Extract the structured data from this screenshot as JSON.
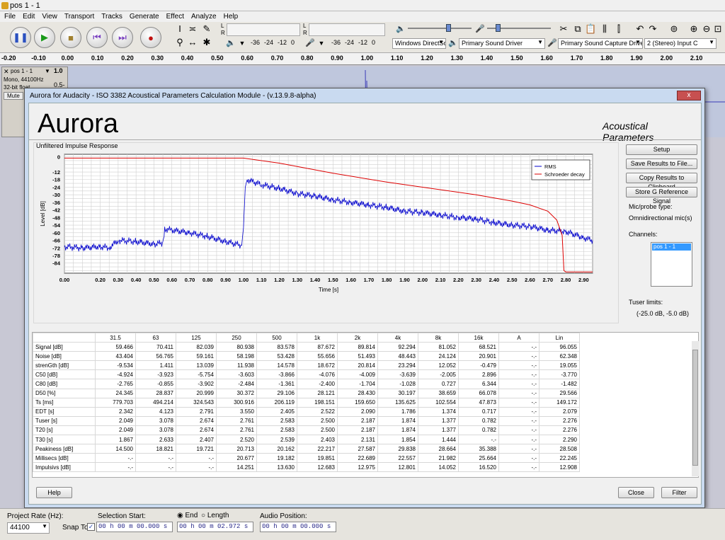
{
  "window": {
    "title": "pos 1 - 1"
  },
  "menu": [
    "File",
    "Edit",
    "View",
    "Transport",
    "Tracks",
    "Generate",
    "Effect",
    "Analyze",
    "Help"
  ],
  "toolbar": {
    "meter_play_ticks": [
      "-36",
      "-24",
      "-12",
      "0"
    ],
    "meter_rec_ticks": [
      "-36",
      "-24",
      "-12",
      "0"
    ],
    "host": "Windows DirectSo",
    "output_device": "Primary Sound Driver",
    "input_device": "Primary Sound Capture Driver",
    "channels": "2 (Stereo) Input C",
    "meter_l": "L",
    "meter_r": "R"
  },
  "ruler": [
    "-0.20",
    "-0.10",
    "0.00",
    "0.10",
    "0.20",
    "0.30",
    "0.40",
    "0.50",
    "0.60",
    "0.70",
    "0.80",
    "0.90",
    "1.00",
    "1.10",
    "1.20",
    "1.30",
    "1.40",
    "1.50",
    "1.60",
    "1.70",
    "1.80",
    "1.90",
    "2.00",
    "2.10"
  ],
  "track": {
    "name": "pos 1 - 1",
    "info1": "Mono, 44100Hz",
    "info2": "32-bit float",
    "mute": "Mute",
    "scale_top": "1.0",
    "scale_mid": "0.5-"
  },
  "dialog": {
    "title": "Aurora for Audacity - ISO 3382 Acoustical Parameters Calculation Module - (v.13.9.8-alpha)",
    "close": "x",
    "brand": "Aurora",
    "heading": "Acoustical Parameters",
    "plot_label": "Unfiltered Impulse Response",
    "buttons": {
      "setup": "Setup",
      "save": "Save Results to File...",
      "copy": "Copy Results to Clipboard",
      "store": "Store G Reference Signal",
      "help": "Help",
      "close": "Close",
      "filter": "Filter"
    },
    "mic_label": "Mic/probe type:",
    "mic_value": "Omnidirectional mic(s)",
    "channels_label": "Channels:",
    "channels": [
      "pos 1 - 1"
    ],
    "tuser_label": "Tuser limits:",
    "tuser_value": "(-25.0 dB, -5.0 dB)"
  },
  "chart_data": {
    "type": "line",
    "title": "",
    "xlabel": "Time [s]",
    "ylabel": "Level [dB]",
    "xlim": [
      0,
      2.95
    ],
    "ylim": [
      -92,
      2
    ],
    "xticks": [
      "0.00",
      "0.20",
      "0.30",
      "0.40",
      "0.50",
      "0.60",
      "0.70",
      "0.80",
      "0.90",
      "1.00",
      "1.10",
      "1.20",
      "1.30",
      "1.40",
      "1.50",
      "1.60",
      "1.70",
      "1.80",
      "1.90",
      "2.00",
      "2.10",
      "2.20",
      "2.30",
      "2.40",
      "2.50",
      "2.60",
      "2.70",
      "2.80",
      "2.90"
    ],
    "yticks": [
      "0",
      "-12",
      "-18",
      "-24",
      "-30",
      "-36",
      "-42",
      "-48",
      "-54",
      "-60",
      "-66",
      "-72",
      "-78",
      "-84"
    ],
    "legend_position": "top-right",
    "grid": true,
    "series": [
      {
        "name": "RMS",
        "color": "#0000cc",
        "x": [
          0,
          0.1,
          0.2,
          0.25,
          0.3,
          0.4,
          0.5,
          0.55,
          0.56,
          0.6,
          0.7,
          0.8,
          0.9,
          0.99,
          1.0,
          1.01,
          1.02,
          1.1,
          1.2,
          1.3,
          1.4,
          1.5,
          1.6,
          1.7,
          1.8,
          1.9,
          2.0,
          2.1,
          2.2,
          2.3,
          2.4,
          2.5,
          2.6,
          2.7,
          2.8,
          2.9,
          2.95
        ],
        "y": [
          -71,
          -72,
          -71,
          -72,
          -66,
          -67,
          -69,
          -68,
          -57,
          -58,
          -60,
          -63,
          -67,
          -70,
          -56,
          -24,
          -18,
          -22,
          -25,
          -29,
          -31,
          -34,
          -36,
          -38,
          -40,
          -43,
          -44,
          -46,
          -48,
          -49,
          -52,
          -54,
          -55,
          -58,
          -59,
          -64,
          -66
        ]
      },
      {
        "name": "Schroeder decay",
        "color": "#dd0000",
        "x": [
          0,
          0.5,
          1.0,
          1.2,
          1.5,
          1.8,
          2.0,
          2.3,
          2.5,
          2.6,
          2.7,
          2.75,
          2.78,
          2.79,
          2.8,
          2.95
        ],
        "y": [
          -1,
          -1,
          -1,
          -5,
          -13,
          -20,
          -24,
          -30,
          -35,
          -38,
          -43,
          -50,
          -62,
          -90,
          -91,
          -91
        ]
      }
    ]
  },
  "table": {
    "columns": [
      "31.5",
      "63",
      "125",
      "250",
      "500",
      "1k",
      "2k",
      "4k",
      "8k",
      "16k",
      "A",
      "Lin"
    ],
    "rows": [
      {
        "label": "Signal [dB]",
        "values": [
          "59.466",
          "70.411",
          "82.039",
          "80.938",
          "83.578",
          "87.672",
          "89.814",
          "92.294",
          "81.052",
          "68.521",
          "-.-",
          "96.055"
        ]
      },
      {
        "label": "Noise [dB]",
        "values": [
          "43.404",
          "56.765",
          "59.161",
          "58.198",
          "53.428",
          "55.656",
          "51.493",
          "48.443",
          "24.124",
          "20.901",
          "-.-",
          "62.348"
        ]
      },
      {
        "label": "strenGth [dB]",
        "values": [
          "-9.534",
          "1.411",
          "13.039",
          "11.938",
          "14.578",
          "18.672",
          "20.814",
          "23.294",
          "12.052",
          "-0.479",
          "-.-",
          "19.055"
        ]
      },
      {
        "label": "C50 [dB]",
        "values": [
          "-4.924",
          "-3.923",
          "-5.754",
          "-3.603",
          "-3.866",
          "-4.076",
          "-4.009",
          "-3.639",
          "-2.005",
          "2.896",
          "-.-",
          "-3.770"
        ]
      },
      {
        "label": "C80 [dB]",
        "values": [
          "-2.765",
          "-0.855",
          "-3.902",
          "-2.484",
          "-1.361",
          "-2.400",
          "-1.704",
          "-1.028",
          "0.727",
          "6.344",
          "-.-",
          "-1.482"
        ]
      },
      {
        "label": "D50 [%]",
        "values": [
          "24.345",
          "28.837",
          "20.999",
          "30.372",
          "29.106",
          "28.121",
          "28.430",
          "30.197",
          "38.659",
          "66.078",
          "-.-",
          "29.566"
        ]
      },
      {
        "label": "Ts [ms]",
        "values": [
          "779.703",
          "494.214",
          "324.543",
          "300.916",
          "206.119",
          "198.151",
          "159.650",
          "135.625",
          "102.554",
          "47.873",
          "-.-",
          "149.172"
        ]
      },
      {
        "label": "EDT [s]",
        "values": [
          "2.342",
          "4.123",
          "2.791",
          "3.550",
          "2.405",
          "2.522",
          "2.090",
          "1.786",
          "1.374",
          "0.717",
          "-.-",
          "2.079"
        ]
      },
      {
        "label": "Tuser [s]",
        "values": [
          "2.049",
          "3.078",
          "2.674",
          "2.761",
          "2.583",
          "2.500",
          "2.187",
          "1.874",
          "1.377",
          "0.782",
          "-.-",
          "2.276"
        ]
      },
      {
        "label": "T20 [s]",
        "values": [
          "2.049",
          "3.078",
          "2.674",
          "2.761",
          "2.583",
          "2.500",
          "2.187",
          "1.874",
          "1.377",
          "0.782",
          "-.-",
          "2.276"
        ]
      },
      {
        "label": "T30 [s]",
        "values": [
          "1.867",
          "2.633",
          "2.407",
          "2.520",
          "2.539",
          "2.403",
          "2.131",
          "1.854",
          "1.444",
          "-.-",
          "-.-",
          "2.290"
        ]
      },
      {
        "label": "Peakiness [dB]",
        "values": [
          "14.500",
          "18.821",
          "19.721",
          "20.713",
          "20.162",
          "22.217",
          "27.587",
          "29.838",
          "28.664",
          "35.388",
          "-.-",
          "28.508"
        ]
      },
      {
        "label": "Millisecs [dB]",
        "values": [
          "-.-",
          "-.-",
          "-.-",
          "20.677",
          "19.182",
          "19.851",
          "22.689",
          "22.557",
          "21.982",
          "25.664",
          "-.-",
          "22.245"
        ]
      },
      {
        "label": "Impulsivs [dB]",
        "values": [
          "-.-",
          "-.-",
          "-.-",
          "14.251",
          "13.630",
          "12.683",
          "12.975",
          "12.801",
          "14.052",
          "16.520",
          "-.-",
          "12.908"
        ]
      }
    ]
  },
  "status": {
    "rate_label": "Project Rate (Hz):",
    "rate_value": "44100",
    "sel_label": "Selection Start:",
    "end_label": "End",
    "length_label": "Length",
    "audio_label": "Audio Position:",
    "snap_label": "Snap To",
    "sel_start": "00 h 00 m 00.000 s",
    "sel_end": "00 h 00 m 02.972 s",
    "audio_pos": "00 h 00 m 00.000 s"
  }
}
